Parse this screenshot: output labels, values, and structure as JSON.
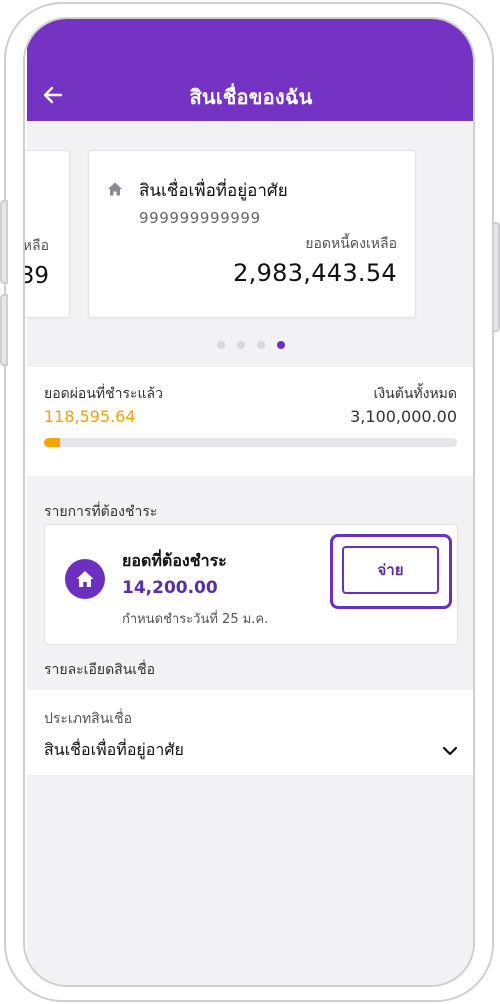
{
  "header": {
    "title": "สินเชื่อของฉัน"
  },
  "carousel": {
    "prev_card": {
      "label_fragment": "หลือ",
      "amount_fragment": "39"
    },
    "current_card": {
      "name": "สินเชื่อเพื่อที่อยู่อาศัย",
      "account_number": "999999999999",
      "remaining_label": "ยอดหนี้คงเหลือ",
      "remaining_amount": "2,983,443.54",
      "icon": "house-icon"
    },
    "page_count": 4,
    "active_page": 4
  },
  "progress": {
    "paid_label": "ยอดผ่อนที่ชำระแล้ว",
    "paid_value": "118,595.64",
    "total_label": "เงินต้นทั้งหมด",
    "total_value": "3,100,000.00",
    "paid_fraction": 0.038,
    "bar_color": "#f5a500"
  },
  "due_section": {
    "title": "รายการที่ต้องชำระ",
    "item": {
      "icon": "house-icon",
      "label": "ยอดที่ต้องชำระ",
      "amount": "14,200.00",
      "due_text": "กำหนดชำระวันที่ 25 ม.ค.",
      "pay_button": "จ่าย"
    }
  },
  "detail_section": {
    "title": "รายละเอียดสินเชื่อ",
    "type_label": "ประเภทสินเชื่อ",
    "type_value": "สินเชื่อเพื่อที่อยู่อาศัย"
  },
  "colors": {
    "brand": "#7433c3",
    "accent": "#6d2fc0",
    "progress": "#f5a500",
    "background": "#f2f2f5"
  }
}
